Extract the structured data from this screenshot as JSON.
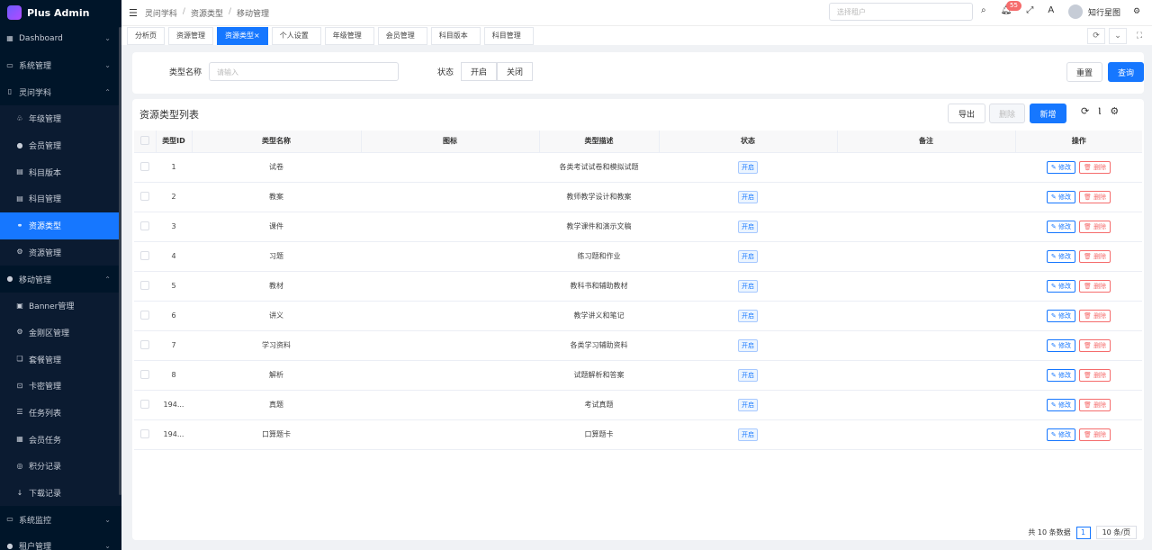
{
  "app": {
    "name": "Plus Admin"
  },
  "sidebar": {
    "items": [
      {
        "label": "Dashboard",
        "icon": "grid-icon",
        "level": 0,
        "expanded": false
      },
      {
        "label": "系统管理",
        "icon": "monitor-icon",
        "level": 0,
        "expanded": false
      },
      {
        "label": "灵问学科",
        "icon": "book-icon",
        "level": 0,
        "expanded": true
      },
      {
        "label": "年级管理",
        "icon": "leaf-icon",
        "level": 1
      },
      {
        "label": "会员管理",
        "icon": "users-icon",
        "level": 1
      },
      {
        "label": "科目版本",
        "icon": "doc-icon",
        "level": 1
      },
      {
        "label": "科目管理",
        "icon": "doc-icon",
        "level": 1
      },
      {
        "label": "资源类型",
        "icon": "link-icon",
        "level": 1,
        "active": true
      },
      {
        "label": "资源管理",
        "icon": "settings-icon",
        "level": 1
      },
      {
        "label": "移动管理",
        "icon": "users-icon",
        "level": 0,
        "expanded": true
      },
      {
        "label": "Banner管理",
        "icon": "image-icon",
        "level": 1
      },
      {
        "label": "金刚区管理",
        "icon": "settings-icon",
        "level": 1
      },
      {
        "label": "套餐管理",
        "icon": "gift-icon",
        "level": 1
      },
      {
        "label": "卡密管理",
        "icon": "lock-icon",
        "level": 1
      },
      {
        "label": "任务列表",
        "icon": "list-icon",
        "level": 1
      },
      {
        "label": "会员任务",
        "icon": "grid-icon",
        "level": 1
      },
      {
        "label": "积分记录",
        "icon": "coin-icon",
        "level": 1
      },
      {
        "label": "下载记录",
        "icon": "download-icon",
        "level": 1
      },
      {
        "label": "系统监控",
        "icon": "monitor-icon",
        "level": 0,
        "expanded": false
      },
      {
        "label": "租户管理",
        "icon": "users-icon",
        "level": 0,
        "expanded": false
      }
    ]
  },
  "header": {
    "breadcrumb": [
      "灵问学科",
      "资源类型",
      "移动管理"
    ],
    "tenant_placeholder": "选择租户",
    "notify_count": "55",
    "user_name": "知行星图"
  },
  "tabs": [
    {
      "label": "分析页"
    },
    {
      "label": "资源管理"
    },
    {
      "label": "资源类型",
      "active": true
    },
    {
      "label": "个人设置"
    },
    {
      "label": "年级管理"
    },
    {
      "label": "会员管理"
    },
    {
      "label": "科目版本"
    },
    {
      "label": "科目管理"
    }
  ],
  "search": {
    "type_name_label": "类型名称",
    "type_name_placeholder": "请输入",
    "status_label": "状态",
    "status_options": [
      "开启",
      "关闭"
    ],
    "reset_label": "重置",
    "query_label": "查询"
  },
  "panel": {
    "title": "资源类型列表",
    "export_label": "导出",
    "delete_label": "删除",
    "add_label": "新增",
    "columns": [
      "类型ID",
      "类型名称",
      "图标",
      "类型描述",
      "状态",
      "备注",
      "操作"
    ],
    "rows": [
      {
        "id": "1",
        "name": "试卷",
        "icon": "",
        "desc": "各类考试试卷和模拟试题",
        "status": "开启",
        "remark": ""
      },
      {
        "id": "2",
        "name": "教案",
        "icon": "",
        "desc": "教师教学设计和教案",
        "status": "开启",
        "remark": ""
      },
      {
        "id": "3",
        "name": "课件",
        "icon": "",
        "desc": "教学课件和演示文稿",
        "status": "开启",
        "remark": ""
      },
      {
        "id": "4",
        "name": "习题",
        "icon": "",
        "desc": "练习题和作业",
        "status": "开启",
        "remark": ""
      },
      {
        "id": "5",
        "name": "教材",
        "icon": "",
        "desc": "教科书和辅助教材",
        "status": "开启",
        "remark": ""
      },
      {
        "id": "6",
        "name": "讲义",
        "icon": "",
        "desc": "教学讲义和笔记",
        "status": "开启",
        "remark": ""
      },
      {
        "id": "7",
        "name": "学习资料",
        "icon": "",
        "desc": "各类学习辅助资料",
        "status": "开启",
        "remark": ""
      },
      {
        "id": "8",
        "name": "解析",
        "icon": "",
        "desc": "试题解析和答案",
        "status": "开启",
        "remark": ""
      },
      {
        "id": "194...",
        "name": "真题",
        "icon": "",
        "desc": "考试真题",
        "status": "开启",
        "remark": ""
      },
      {
        "id": "194...",
        "name": "口算题卡",
        "icon": "",
        "desc": "口算题卡",
        "status": "开启",
        "remark": ""
      }
    ],
    "edit_label": "修改",
    "row_delete_label": "删除"
  },
  "pager": {
    "total_text": "共 10 条数据",
    "current": "1",
    "size": "10 条/页"
  }
}
